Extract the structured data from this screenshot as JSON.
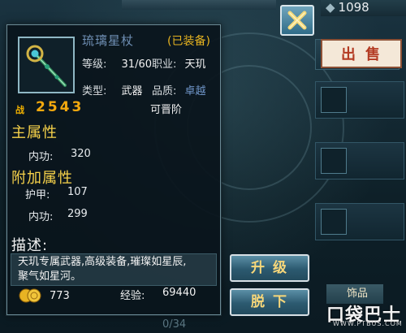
{
  "background": {
    "gold_counter": "1098",
    "sell_button": "出售",
    "bottom_tab_label": "饰品",
    "bottom_counter": "0/34"
  },
  "watermark": {
    "main": "口袋巴士",
    "sub": "WWW.PTBUS.COM"
  },
  "item": {
    "name": "琉璃星杖",
    "equipped_tag": "(已装备)",
    "level_label": "等级:",
    "level_value": "31/60",
    "class_label": "职业:",
    "class_value": "天玑",
    "type_label": "类型:",
    "type_value": "武器",
    "quality_label": "品质:",
    "quality_value": "卓越",
    "power_icon_text": "战",
    "power_value": "2543",
    "upgrade_status": "可晋阶"
  },
  "main_attributes": {
    "title": "主属性",
    "stats": [
      {
        "label": "内功:",
        "value": "320"
      }
    ]
  },
  "extra_attributes": {
    "title": "附加属性",
    "stats": [
      {
        "label": "护甲:",
        "value": "107"
      },
      {
        "label": "内功:",
        "value": "299"
      }
    ]
  },
  "description": {
    "title": "描述:",
    "text": "天玑专属武器,高级装备,璀璨如星辰,聚气如星河。"
  },
  "footer": {
    "coins_value": "773",
    "exp_label": "经验:",
    "exp_value": "69440"
  },
  "buttons": {
    "upgrade": "升级",
    "unequip": "脱下"
  },
  "colors": {
    "equipped_tag": "#e6b320",
    "power_value": "#f3a90e",
    "section_title": "#f7d24a",
    "rarity": "#6f95c8"
  }
}
